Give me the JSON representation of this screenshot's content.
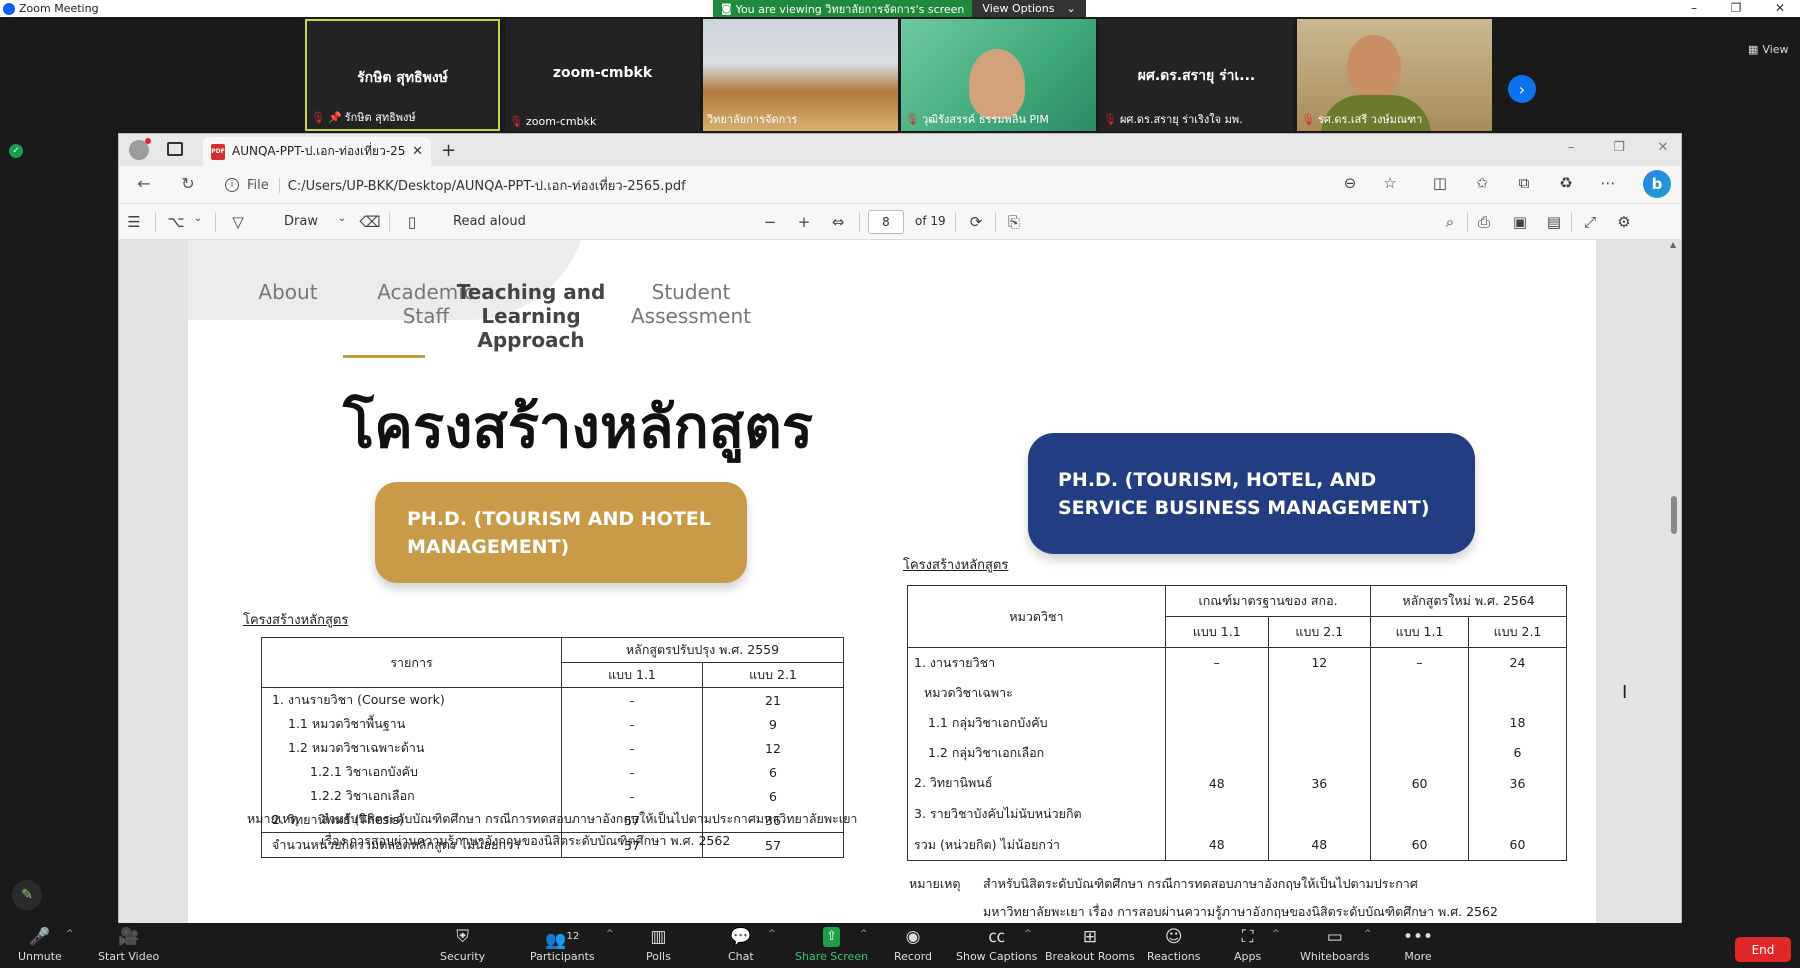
{
  "zoom": {
    "window_title": "Zoom Meeting",
    "banner_text": "You are viewing วิทยาลัยการจัดการ's screen",
    "view_options": "View Options",
    "view_label": "View",
    "tiles": [
      {
        "big": "รักษิต สุทธิพงษ์",
        "label": "รักษิต สุทธิพงษ์"
      },
      {
        "big": "zoom-cmbkk",
        "label": "zoom-cmbkk"
      },
      {
        "big": "",
        "label": "วิทยาลัยการจัดการ"
      },
      {
        "big": "",
        "label": "วุฒิรังสรรค์ ธรรมพลิน PIM"
      },
      {
        "big": "ผศ.ดร.สรายุ ร่าเ...",
        "label": "ผศ.ดร.สรายุ ร่าเริงใจ มพ."
      },
      {
        "big": "",
        "label": "รศ.ดร.เสรี วงษ์มณฑา"
      }
    ],
    "toolbar": {
      "unmute": "Unmute",
      "start_video": "Start Video",
      "security": "Security",
      "participants": "Participants",
      "participants_count": "12",
      "polls": "Polls",
      "chat": "Chat",
      "share_screen": "Share Screen",
      "record": "Record",
      "show_captions": "Show Captions",
      "breakout_rooms": "Breakout Rooms",
      "reactions": "Reactions",
      "apps": "Apps",
      "whiteboards": "Whiteboards",
      "more": "More",
      "end": "End"
    }
  },
  "browser": {
    "tab_title": "AUNQA-PPT-ป.เอก-ท่องเที่ยว-2565.pdf",
    "file_label": "File",
    "url": "C:/Users/UP-BKK/Desktop/AUNQA-PPT-ป.เอก-ท่องเที่ยว-2565.pdf",
    "pdf_toolbar": {
      "draw": "Draw",
      "read_aloud": "Read aloud",
      "page_number": "8",
      "page_of": "of 19"
    }
  },
  "slide": {
    "nav": {
      "about": "About",
      "academic_staff": "Academic Staff",
      "teaching": "Teaching and Learning Approach",
      "assessment": "Student Assessment"
    },
    "title": "โครงสร้างหลักสูตร",
    "program_left": "PH.D. (TOURISM AND HOTEL MANAGEMENT)",
    "program_right": "PH.D. (TOURISM, HOTEL, AND SERVICE BUSINESS MANAGEMENT)",
    "table_left": {
      "caption": "โครงสร้างหลักสูตร",
      "col_item": "รายการ",
      "col_group": "หลักสูตรปรับปรุง พ.ศ. 2559",
      "col_a": "แบบ 1.1",
      "col_b": "แบบ 2.1",
      "rows": [
        {
          "label": "1.  งานรายวิชา (Course work)",
          "a": "-",
          "b": "21"
        },
        {
          "label": "1.1  หมวดวิชาพื้นฐาน",
          "a": "-",
          "b": "9"
        },
        {
          "label": "1.2  หมวดวิชาเฉพาะด้าน",
          "a": "-",
          "b": "12"
        },
        {
          "label": "1.2.1  วิชาเอกบังคับ",
          "a": "-",
          "b": "6"
        },
        {
          "label": "1.2.2  วิชาเอกเลือก",
          "a": "-",
          "b": "6"
        },
        {
          "label": "2.  วิทยานิพนธ์ (Thesis)",
          "a": "57",
          "b": "36"
        },
        {
          "label": "จำนวนหน่วยกิตรวมตลอดหลักสูตร ไม่น้อยกว่า",
          "a": "57",
          "b": "57"
        }
      ],
      "note_label": "หมายเหตุ",
      "note_line1": "สำหรับนิสิตระดับบัณฑิตศึกษา กรณีการทดสอบภาษาอังกฤษให้เป็นไปตามประกาศมหาวิทยาลัยพะเยา",
      "note_line2": "เรื่อง การสอบผ่านความรู้ภาษาอังกฤษของนิสิตระดับบัณฑิตศึกษา พ.ศ. 2562"
    },
    "table_right": {
      "caption": "โครงสร้างหลักสูตร",
      "col_item": "หมวดวิชา",
      "col_group1": "เกณฑ์มาตรฐานของ สกอ.",
      "col_group2": "หลักสูตรใหม่ พ.ศ. 2564",
      "col_a": "แบบ 1.1",
      "col_b": "แบบ 2.1",
      "col_c": "แบบ 1.1",
      "col_d": "แบบ 2.1",
      "rows": [
        {
          "label": "1. งานรายวิชา",
          "a": "–",
          "b": "12",
          "c": "–",
          "d": "24"
        },
        {
          "label": "หมวดวิชาเฉพาะ",
          "a": "",
          "b": "",
          "c": "",
          "d": ""
        },
        {
          "label": "1.1 กลุ่มวิชาเอกบังคับ",
          "a": "",
          "b": "",
          "c": "",
          "d": "18"
        },
        {
          "label": "1.2 กลุ่มวิชาเอกเลือก",
          "a": "",
          "b": "",
          "c": "",
          "d": "6"
        },
        {
          "label": "2. วิทยานิพนธ์",
          "a": "48",
          "b": "36",
          "c": "60",
          "d": "36"
        },
        {
          "label": "3. รายวิชาบังคับไม่นับหน่วยกิต",
          "a": "",
          "b": "",
          "c": "",
          "d": ""
        },
        {
          "label": "รวม  (หน่วยกิต)  ไม่น้อยกว่า",
          "a": "48",
          "b": "48",
          "c": "60",
          "d": "60"
        }
      ],
      "note_label": "หมายเหตุ",
      "note_line1": "สำหรับนิสิตระดับบัณฑิตศึกษา กรณีการทดสอบภาษาอังกฤษให้เป็นไปตามประกาศ",
      "note_line2": "มหาวิทยาลัยพะเยา เรื่อง การสอบผ่านความรู้ภาษาอังกฤษของนิสิตระดับบัณฑิตศึกษา พ.ศ. 2562"
    }
  },
  "colors": {
    "gold": "#c99a47",
    "navy": "#233d83",
    "zoom_blue": "#0e72ed",
    "banner_green": "#1f8a3c",
    "end_red": "#e02828"
  }
}
